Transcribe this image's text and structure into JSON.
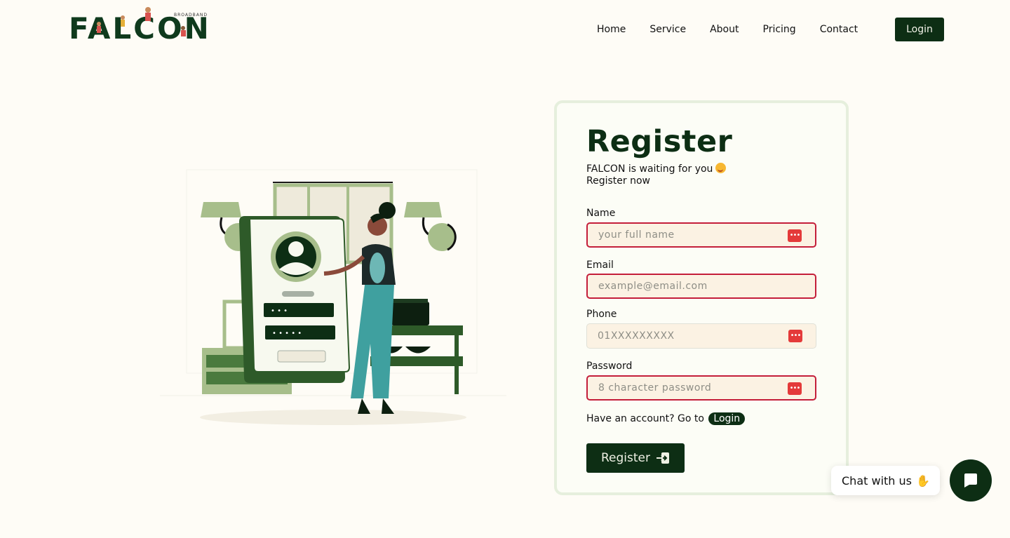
{
  "header": {
    "logo_text": "FALCON",
    "logo_subtext": "BROADBAND",
    "nav": [
      "Home",
      "Service",
      "About",
      "Pricing",
      "Contact"
    ],
    "login_label": "Login"
  },
  "register": {
    "title": "Register",
    "subtitle_line1": "FALCON is waiting for you",
    "subtitle_line2": "Register now",
    "fields": {
      "name": {
        "label": "Name",
        "placeholder": "your full name"
      },
      "email": {
        "label": "Email",
        "placeholder": "example@email.com"
      },
      "phone": {
        "label": "Phone",
        "placeholder": "01XXXXXXXXX"
      },
      "password": {
        "label": "Password",
        "placeholder": "8 character password"
      }
    },
    "have_account": "Have an account? Go to",
    "login_link": "Login",
    "submit_label": "Register"
  },
  "chat": {
    "bubble_text": "Chat with us"
  },
  "icons": {
    "password_manager": "password-manager-icon",
    "register": "login-arrow-icon",
    "chat": "chat-icon",
    "emoji": "smiling-face-icon",
    "wave": "waving-hand-icon"
  },
  "colors": {
    "brand_dark": "#0d2e14",
    "error_border": "#c41e3a",
    "page_bg": "#fefcf6",
    "field_bg": "#fbf2e3"
  }
}
